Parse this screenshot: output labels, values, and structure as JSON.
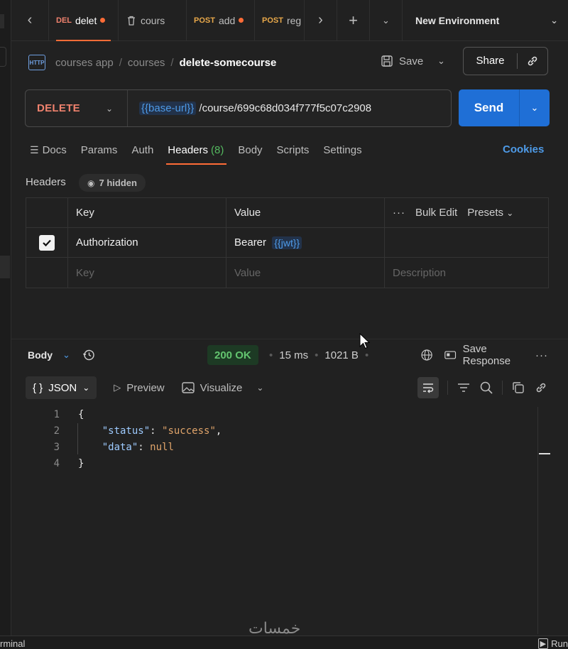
{
  "tabs": [
    {
      "method": "DEL",
      "method_color": "#f0826e",
      "name": "delet",
      "dirty": true,
      "active": true
    },
    {
      "method": "",
      "name": "cours",
      "icon": "trash-icon",
      "dirty": false,
      "active": false
    },
    {
      "method": "POST",
      "method_color": "#e8a84a",
      "name": "add",
      "dirty": true,
      "active": false
    },
    {
      "method": "POST",
      "method_color": "#e8a84a",
      "name": "reg",
      "dirty": false,
      "active": false
    }
  ],
  "environment": "New Environment",
  "breadcrumb": {
    "icon_label": "HTTP",
    "items": [
      "courses app",
      "courses"
    ],
    "current": "delete-somecourse"
  },
  "toolbar": {
    "save": "Save",
    "share": "Share"
  },
  "request": {
    "method": "DELETE",
    "url_var": "{{base-url}}",
    "url_path": " /course/699c68d034f777f5c07c2908",
    "send": "Send"
  },
  "request_tabs": [
    "Docs",
    "Params",
    "Auth",
    "Headers",
    "Body",
    "Scripts",
    "Settings"
  ],
  "headers_count": "(8)",
  "cookies": "Cookies",
  "headers_section": {
    "label": "Headers",
    "hidden": "7 hidden"
  },
  "header_table": {
    "columns": [
      "Key",
      "Value"
    ],
    "bulk_edit": "Bulk Edit",
    "presets": "Presets",
    "rows": [
      {
        "key": "Authorization",
        "value_prefix": "Bearer",
        "value_var": "{{jwt}}"
      }
    ],
    "placeholders": {
      "key": "Key",
      "value": "Value",
      "description": "Description"
    }
  },
  "response": {
    "body_label": "Body",
    "status": "200 OK",
    "time": "15 ms",
    "size": "1021 B",
    "save_response": "Save Response",
    "format": "JSON",
    "preview": "Preview",
    "visualize": "Visualize",
    "lines": [
      "1",
      "2",
      "3",
      "4"
    ],
    "code": {
      "open": "{",
      "status_key": "\"status\"",
      "status_val": "\"success\"",
      "data_key": "\"data\"",
      "data_val": "null",
      "close": "}"
    }
  },
  "footer": {
    "terminal": "rminal",
    "run": "Run"
  },
  "watermark": "خمسات",
  "colors": {
    "accent": "#ff6c37",
    "send": "#1f6fd6",
    "delete": "#f0826e",
    "success": "#63c46f",
    "variable": "#4e9be8"
  }
}
